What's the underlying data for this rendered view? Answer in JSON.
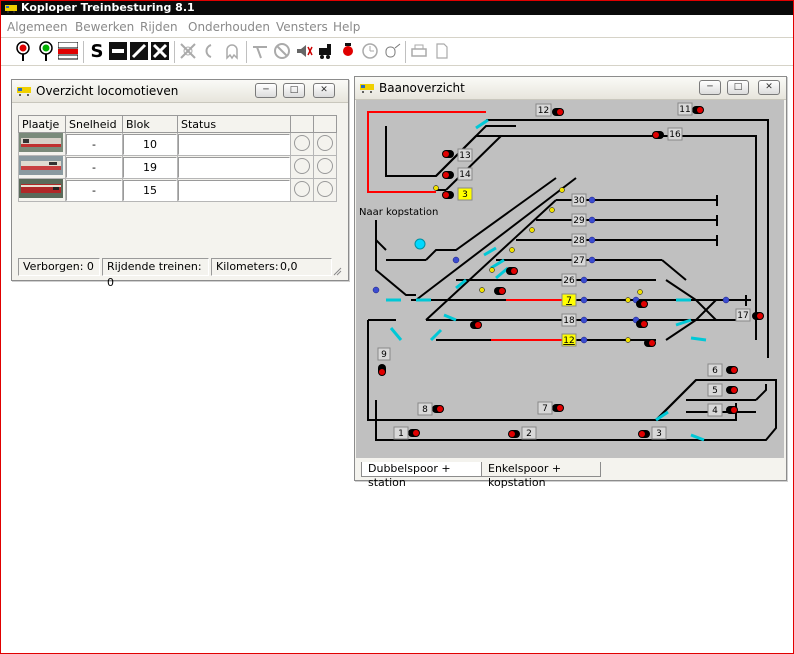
{
  "app": {
    "title": "Koploper Treinbesturing 8.1"
  },
  "menu": {
    "items": [
      "Algemeen",
      "Bewerken",
      "Rijden",
      "Onderhouden",
      "Vensters",
      "Help"
    ]
  },
  "toolbar": {
    "buttons": [
      "signal-red-icon",
      "signal-green-icon",
      "power-icon",
      "s-icon",
      "block-icon",
      "diagonal-icon",
      "cross-icon",
      "loco-off-icon",
      "whistle-icon",
      "ghost-icon",
      "turnout-icon",
      "stop-icon",
      "sound-icon",
      "locomotive-icon",
      "light-icon",
      "clock-icon",
      "mouse-icon",
      "print-icon",
      "page-icon"
    ],
    "s_label": "S"
  },
  "loco_window": {
    "title": "Overzicht locomotieven",
    "columns": [
      "Plaatje",
      "Snelheid",
      "Blok",
      "Status"
    ],
    "rows": [
      {
        "speed": "-",
        "block": "10",
        "status": ""
      },
      {
        "speed": "-",
        "block": "19",
        "status": ""
      },
      {
        "speed": "-",
        "block": "15",
        "status": ""
      }
    ],
    "status_bar": {
      "hidden": "Verborgen: 0",
      "driving": "Rijdende treinen: 0",
      "km_label": "Kilometers:",
      "km_value": "0,0"
    }
  },
  "track_window": {
    "title": "Baanoverzicht",
    "label_kopstation": "Naar kopstation",
    "blocks": {
      "b12top": "12",
      "b11": "11",
      "b16": "16",
      "b13": "13",
      "b14": "14",
      "b3y": "3",
      "b30": "30",
      "b29": "29",
      "b28": "28",
      "b27": "27",
      "b26": "26",
      "b7": "7",
      "b17": "17",
      "b18": "18",
      "b12y": "12",
      "b9": "9",
      "b6": "6",
      "b5": "5",
      "b4": "4",
      "b8": "8",
      "b7b": "7",
      "b1": "1",
      "b2": "2",
      "b3": "3"
    },
    "tabs": [
      "Dubbelspoor + station",
      "Enkelspoor + kopstation"
    ]
  },
  "colors": {
    "track_bg": "#c0c0c0",
    "track": "#000000",
    "occupied": "#ff0000",
    "turnout": "#00c8d6",
    "highlight_block": "#ffff00"
  }
}
